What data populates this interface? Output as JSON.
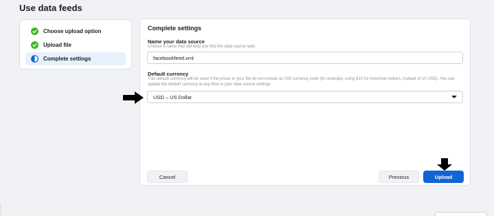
{
  "page": {
    "title": "Use data feeds"
  },
  "steps": [
    {
      "label": "Choose upload option",
      "status": "complete"
    },
    {
      "label": "Upload file",
      "status": "complete"
    },
    {
      "label": "Complete settings",
      "status": "current"
    }
  ],
  "main": {
    "title": "Complete settings",
    "source": {
      "label": "Name your data source",
      "help": "Choose a name that will help you find the data source later.",
      "value": "facebookfeed.xml"
    },
    "currency": {
      "label": "Default currency",
      "help": "This default currency will be used if the prices in your file do not include an ISO currency code (for example, using $10 for American dollars, instead of 10 USD). You can update the default currency at any time in your data source settings",
      "selected": "USD – US Dollar"
    },
    "buttons": {
      "cancel": "Cancel",
      "previous": "Previous",
      "upload": "Upload"
    }
  },
  "colors": {
    "accent": "#1264d6",
    "complete": "#42b72a",
    "background": "#f0f2f5"
  },
  "icons": {
    "complete": "check-circle-icon",
    "current": "half-circle-icon",
    "dropdown": "chevron-down-icon"
  }
}
